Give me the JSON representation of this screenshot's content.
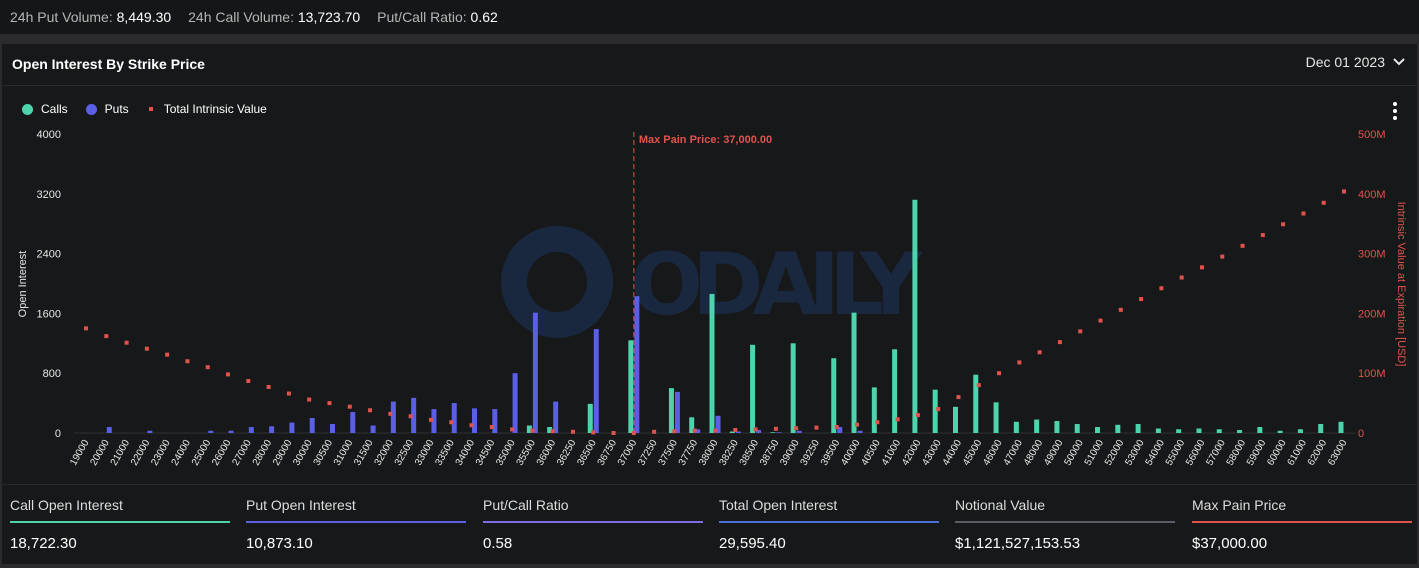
{
  "summary": [
    {
      "label": "24h Put Volume:",
      "value": "8,449.30"
    },
    {
      "label": "24h Call Volume:",
      "value": "13,723.70"
    },
    {
      "label": "Put/Call Ratio:",
      "value": "0.62"
    }
  ],
  "panel": {
    "title": "Open Interest By Strike Price",
    "date": "Dec 01 2023"
  },
  "legend": {
    "calls": "Calls",
    "puts": "Puts",
    "intrinsic": "Total Intrinsic Value"
  },
  "watermark": "ODAILY",
  "colors": {
    "calls": "#4dd4ac",
    "puts": "#5b5fe8",
    "intrinsic": "#e0534d",
    "call_line": "#4dd4ac",
    "put_line": "#5b5fe8",
    "ratio_line": "#7b6ee0",
    "total_line": "#4b6fd6",
    "notional_line": "#5a5d66",
    "maxpain_line": "#e0534d"
  },
  "chart_data": {
    "type": "bar",
    "categories": [
      "19000",
      "20000",
      "21000",
      "22000",
      "23000",
      "24000",
      "25000",
      "26000",
      "27000",
      "28000",
      "29000",
      "30000",
      "30500",
      "31000",
      "31500",
      "32000",
      "32500",
      "33000",
      "33500",
      "34000",
      "34500",
      "35000",
      "35500",
      "36000",
      "36250",
      "36500",
      "36750",
      "37000",
      "37250",
      "37500",
      "37750",
      "38000",
      "38250",
      "38500",
      "38750",
      "39000",
      "39250",
      "39500",
      "40000",
      "40500",
      "41000",
      "42000",
      "43000",
      "44000",
      "45000",
      "46000",
      "47000",
      "48000",
      "49000",
      "50000",
      "51000",
      "52000",
      "53000",
      "54000",
      "55000",
      "56000",
      "57000",
      "58000",
      "59000",
      "60000",
      "61000",
      "62000",
      "63000"
    ],
    "series": [
      {
        "name": "Calls",
        "values": [
          0,
          0,
          0,
          0,
          0,
          0,
          0,
          0,
          0,
          0,
          0,
          0,
          0,
          0,
          0,
          0,
          0,
          0,
          0,
          0,
          0,
          0,
          100,
          80,
          0,
          390,
          0,
          1240,
          0,
          600,
          210,
          1860,
          20,
          1180,
          10,
          1200,
          0,
          1000,
          1610,
          610,
          1120,
          3120,
          580,
          350,
          780,
          410,
          150,
          180,
          160,
          120,
          80,
          110,
          120,
          60,
          50,
          60,
          50,
          40,
          80,
          30,
          50,
          120,
          150
        ]
      },
      {
        "name": "Puts",
        "values": [
          0,
          80,
          0,
          30,
          0,
          0,
          30,
          30,
          80,
          90,
          140,
          200,
          120,
          280,
          100,
          420,
          470,
          320,
          400,
          330,
          320,
          800,
          1610,
          420,
          0,
          1390,
          0,
          1830,
          0,
          550,
          50,
          230,
          20,
          40,
          10,
          30,
          0,
          80,
          30,
          0,
          0,
          0,
          0,
          0,
          0,
          0,
          0,
          0,
          0,
          0,
          0,
          0,
          0,
          0,
          0,
          0,
          0,
          0,
          0,
          0,
          0,
          0,
          0
        ]
      },
      {
        "name": "Total Intrinsic Value",
        "axis": "right",
        "values": [
          175,
          162,
          151,
          141,
          131,
          120,
          110,
          98,
          87,
          77,
          66,
          56,
          50,
          44,
          38,
          32,
          28,
          22,
          18,
          13,
          10,
          6,
          4,
          3,
          2,
          1,
          0,
          0,
          2,
          3,
          4,
          4,
          5,
          6,
          7,
          8,
          9,
          10,
          14,
          18,
          23,
          30,
          40,
          60,
          80,
          100,
          118,
          135,
          152,
          170,
          188,
          206,
          224,
          242,
          260,
          277,
          295,
          313,
          331,
          349,
          367,
          385,
          404
        ]
      }
    ],
    "xlabel": "",
    "ylabel": "Open Interest",
    "ylabel_right": "Intrinsic Value at Expiration [USD]",
    "ylim": [
      0,
      4000
    ],
    "yticks": [
      "0",
      "800",
      "1600",
      "2400",
      "3200",
      "4000"
    ],
    "ylim_right": [
      0,
      500
    ],
    "yticks_right": [
      "0",
      "100M",
      "200M",
      "300M",
      "400M",
      "500M"
    ],
    "annotation": {
      "label": "Max Pain Price: 37,000.00",
      "category": "37000"
    },
    "legend_position": "top-left",
    "grid": false
  },
  "metrics": [
    {
      "label": "Call Open Interest",
      "value": "18,722.30"
    },
    {
      "label": "Put Open Interest",
      "value": "10,873.10"
    },
    {
      "label": "Put/Call Ratio",
      "value": "0.58"
    },
    {
      "label": "Total Open Interest",
      "value": "29,595.40"
    },
    {
      "label": "Notional Value",
      "value": "$1,121,527,153.53"
    },
    {
      "label": "Max Pain Price",
      "value": "$37,000.00"
    }
  ]
}
